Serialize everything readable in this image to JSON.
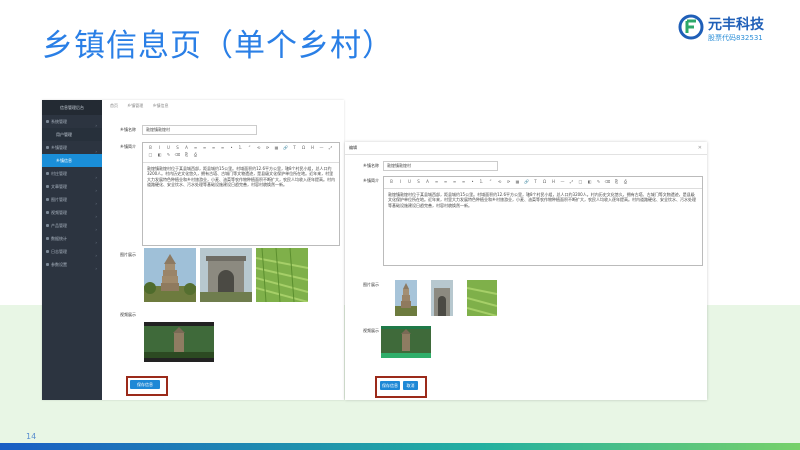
{
  "slide": {
    "title": "乡镇信息页（单个乡村）",
    "page_number": "14"
  },
  "brand": {
    "name": "元丰科技",
    "code": "股票代码832531",
    "colors": {
      "primary": "#1f5fb8",
      "accent": "#2a7fe6"
    }
  },
  "left_screenshot": {
    "sidebar": {
      "header": "信息管理后台",
      "items": [
        {
          "label": "系统管理",
          "sub": false,
          "active": false
        },
        {
          "label": "用户管理",
          "sub": true,
          "active": false
        },
        {
          "label": "乡镇管理",
          "sub": false,
          "active": false
        },
        {
          "label": "乡镇信息",
          "sub": true,
          "active": true
        },
        {
          "label": "村庄管理",
          "sub": false,
          "active": false
        },
        {
          "label": "文章管理",
          "sub": false,
          "active": false
        },
        {
          "label": "图片管理",
          "sub": false,
          "active": false
        },
        {
          "label": "视频管理",
          "sub": false,
          "active": false
        },
        {
          "label": "产品管理",
          "sub": false,
          "active": false
        },
        {
          "label": "数据统计",
          "sub": false,
          "active": false
        },
        {
          "label": "日志管理",
          "sub": false,
          "active": false
        },
        {
          "label": "参数设置",
          "sub": false,
          "active": false
        }
      ]
    },
    "breadcrumb": [
      "首页",
      "乡镇管理",
      "乡镇信息"
    ],
    "form": {
      "name_label": "乡镇名称",
      "name_value": "敦煌镇敦煌村",
      "intro_label": "乡镇简介",
      "intro_text": "敦煌镇敦煌村位于某县城西部，距县城约15公里。村域面积约12.6平方公里，辖8个村民小组，总人口约3200人。村内历史文化悠久，拥有古塔、古城门等文物遗迹，是县级文化保护单位所在地。近年来，村里大力发展特色种植业和乡村旅游业，小麦、油菜等农作物种植面积不断扩大，农民人均收入逐年提高。村内道路硬化、安全饮水、污水处理等基础设施建设日趋完善，村容村貌焕然一新。",
      "images_label": "图片展示",
      "video_label": "视频展示",
      "save_button": "保存信息"
    }
  },
  "right_screenshot": {
    "dialog_title": "编辑",
    "form": {
      "name_label": "乡镇名称",
      "name_value": "敦煌镇敦煌村",
      "intro_label": "乡镇简介",
      "intro_text": "敦煌镇敦煌村位于某县城西部，距县城约15公里。村域面积约12.6平方公里，辖8个村民小组，总人口约3200人。村内历史文化悠久，拥有古塔、古城门等文物遗迹，是县级文化保护单位所在地。近年来，村里大力发展特色种植业和乡村旅游业，小麦、油菜等农作物种植面积不断扩大，农民人均收入逐年提高。村内道路硬化、安全饮水、污水处理等基础设施建设日趋完善，村容村貌焕然一新。",
      "images_label": "图片展示",
      "video_label": "视频展示",
      "save_button": "保存信息",
      "cancel_button": "取消"
    }
  },
  "toolbar_glyphs": [
    "B",
    "I",
    "U",
    "S",
    "A",
    "≡",
    "≡",
    "≡",
    "≡",
    "•",
    "1.",
    "“",
    "⟲",
    "⟳",
    "▦",
    "🔗",
    "T",
    "Ω",
    "H",
    "—",
    "⤢",
    "□",
    "◧",
    "✎",
    "⌫",
    "⎘",
    "⎙"
  ]
}
